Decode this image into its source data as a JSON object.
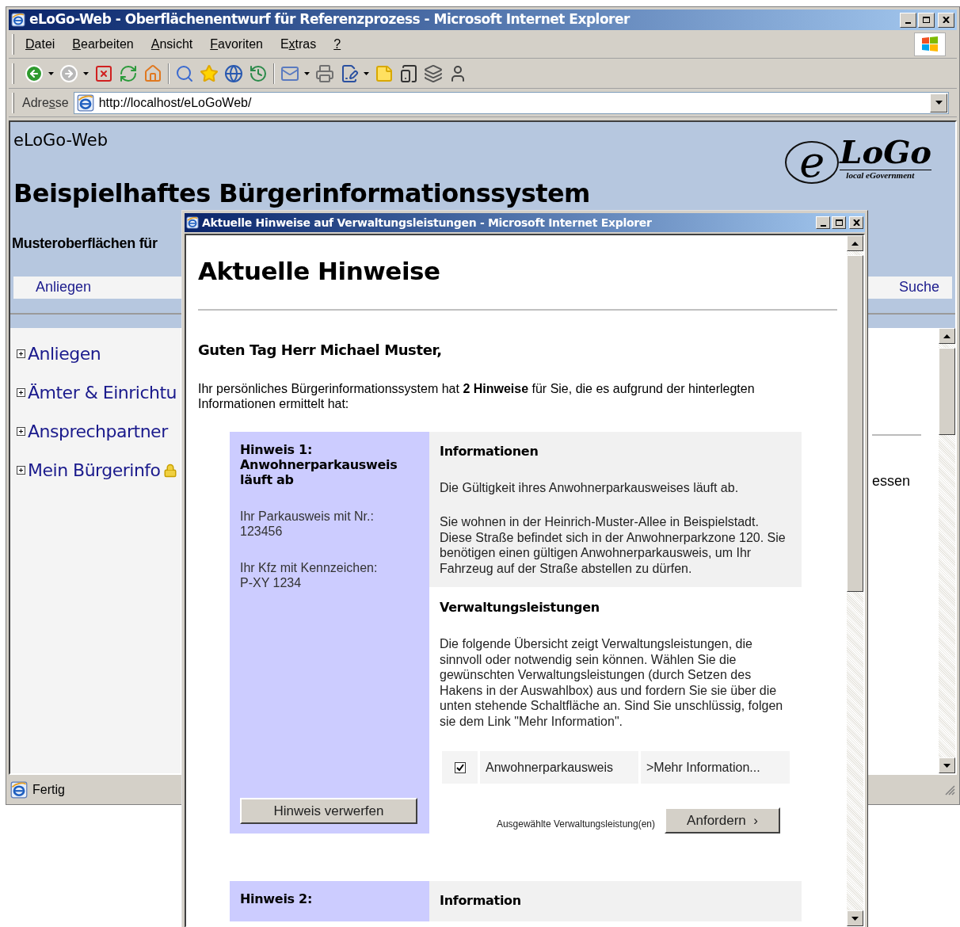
{
  "browser": {
    "title": "eLoGo-Web - Oberflächenentwurf für Referenzprozess - Microsoft Internet Explorer",
    "menu": [
      {
        "key": "D",
        "after": "atei"
      },
      {
        "key": "B",
        "after": "earbeiten"
      },
      {
        "key": "A",
        "after": "nsicht"
      },
      {
        "key": "F",
        "after": "avoriten"
      },
      {
        "before": "E",
        "key": "x",
        "after": "tras"
      },
      {
        "key": "?"
      }
    ],
    "address_label": {
      "before": "Adre",
      "key": "s",
      "after": "se"
    },
    "url": "http://localhost/eLoGoWeb/",
    "status": "Fertig"
  },
  "page": {
    "site_name": "eLoGo-Web",
    "heading": "Beispielhaftes Bürgerinformationssystem",
    "subheading": "Musteroberflächen für",
    "logo": {
      "letter": "e",
      "wordmark": "LoGo",
      "tagline": "local eGovernment"
    },
    "nav": [
      "Anliegen",
      "Suche"
    ],
    "tree": [
      {
        "label": "Anliegen",
        "expanded": false,
        "locked": false
      },
      {
        "label": "Ämter & Einrichtu",
        "expanded": false,
        "locked": false
      },
      {
        "label": "Ansprechpartner",
        "expanded": false,
        "locked": false
      },
      {
        "label": "Mein Bürgerinfo",
        "expanded": false,
        "locked": true
      }
    ],
    "content_fragment": "essen"
  },
  "popup": {
    "title": "Aktuelle Hinweise auf Verwaltungsleistungen - Microsoft Internet Explorer",
    "heading": "Aktuelle Hinweise",
    "greeting": "Guten Tag Herr Michael Muster,",
    "intro": "Ihr persönliches Bürgerinformationssystem hat **2 Hinweise** für Sie, die es aufgrund der hinterlegten Informationen ermittelt hat:",
    "hints": [
      {
        "title": "Hinweis 1:\nAnwohnerparkausweis\nläuft ab",
        "details": [
          "Ihr Parkausweis mit Nr.:\n123456",
          "Ihr Kfz mit Kennzeichen:\nP-XY 1234"
        ],
        "discard_button": "Hinweis verwerfen",
        "info_heading": "Informationen",
        "info_paragraphs": [
          "Die Gültigkeit ihres Anwohnerparkausweises läuft ab.",
          "Sie wohnen in der Heinrich-Muster-Allee in Beispielstadt. Diese Straße befindet sich in der Anwohnerparkzone 120. Sie benötigen einen gültigen Anwohnerparkausweis, um Ihr Fahrzeug auf der Straße abstellen zu dürfen."
        ],
        "services_heading": "Verwaltungsleistungen",
        "services_text": "Die folgende Übersicht zeigt Verwaltungsleistungen, die sinnvoll oder notwendig sein können. Wählen Sie die gewünschten Verwaltungsleistungen (durch Setzen des Hakens in der Auswahlbox) aus und fordern Sie sie über die unten stehende Schaltfläche an. Sind Sie unschlüssig, folgen sie dem Link \"Mehr Information\".",
        "services": [
          {
            "name": "Anwohnerparkausweis",
            "checked": true,
            "link": ">Mehr Information..."
          }
        ],
        "selected_label": "Ausgewählte Verwaltungsleistung(en)",
        "request_button": "Anfordern  ›"
      },
      {
        "title": "Hinweis 2:",
        "info_heading": "Information"
      }
    ]
  }
}
